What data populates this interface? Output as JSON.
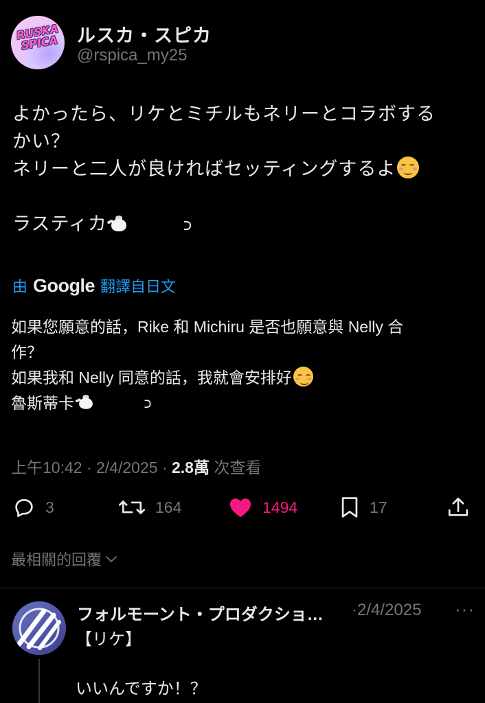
{
  "post": {
    "author": {
      "display_name": "ルスカ・スピカ",
      "handle": "@rspica_my25",
      "avatar_logo_top": "RUSKA",
      "avatar_logo_bottom": "SPICA"
    },
    "text_lines": [
      "よかったら、リケとミチルもネリーとコラボする",
      "かい？",
      "ネリーと二人が良ければセッティングするよ",
      "",
      "ラスティカ"
    ],
    "translation": {
      "prefix": "由",
      "provider": "Google",
      "label": "翻譯自日文",
      "lines": [
        "如果您願意的話，Rike 和 Michiru 是否也願意與 Nelly 合",
        "作？",
        "如果我和 Nelly 同意的話，我就會安排好",
        "魯斯蒂卡"
      ]
    },
    "meta": {
      "time": "上午10:42",
      "date": "2/4/2025",
      "views": "2.8萬",
      "views_label": "次查看",
      "separator": "·"
    },
    "actions": {
      "replies": "3",
      "reposts": "164",
      "likes": "1494",
      "bookmarks": "17"
    },
    "colors": {
      "like": "#f91880",
      "link": "#1d9bf0",
      "secondary_text": "#71767b"
    }
  },
  "sort": {
    "label": "最相關的回覆"
  },
  "reply": {
    "author_name": "フォルモーント・プロダクショ…",
    "date": "2/4/2025",
    "separator": "·",
    "more": "···",
    "text_lines": [
      "【リケ】",
      "",
      "いいんですか！？"
    ]
  }
}
